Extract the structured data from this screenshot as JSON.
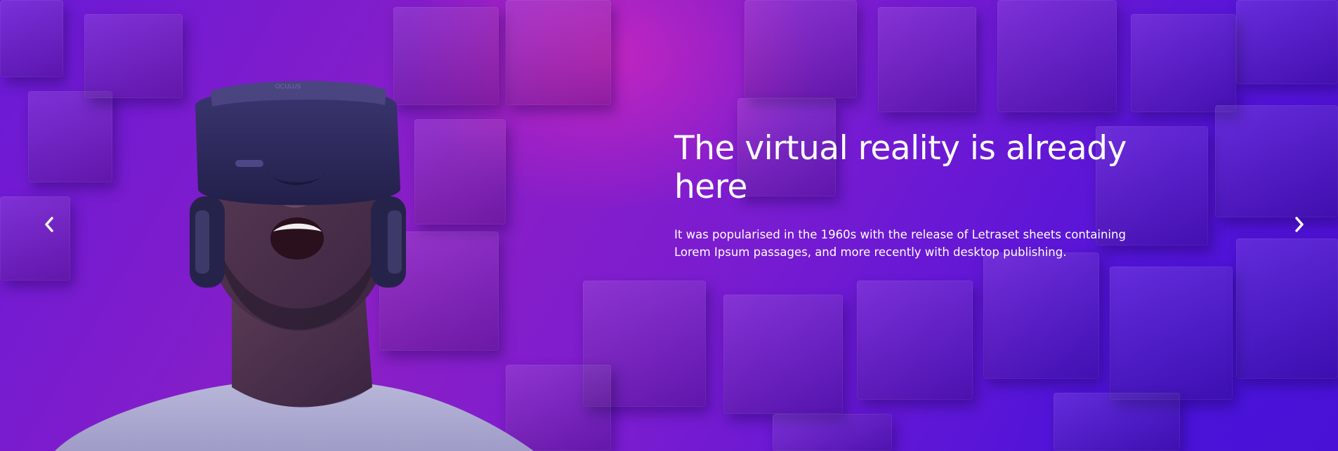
{
  "slide": {
    "title": "The virtual reality is already here",
    "description": "It was popularised in the 1960s with the release of Letraset sheets containing Lorem Ipsum passages, and more recently with desktop publishing."
  },
  "controls": {
    "prev_icon": "chevron-left-icon",
    "next_icon": "chevron-right-icon"
  },
  "colors": {
    "background_primary": "#6a19d6",
    "background_accent": "#c726b4",
    "text": "#ffffff"
  }
}
